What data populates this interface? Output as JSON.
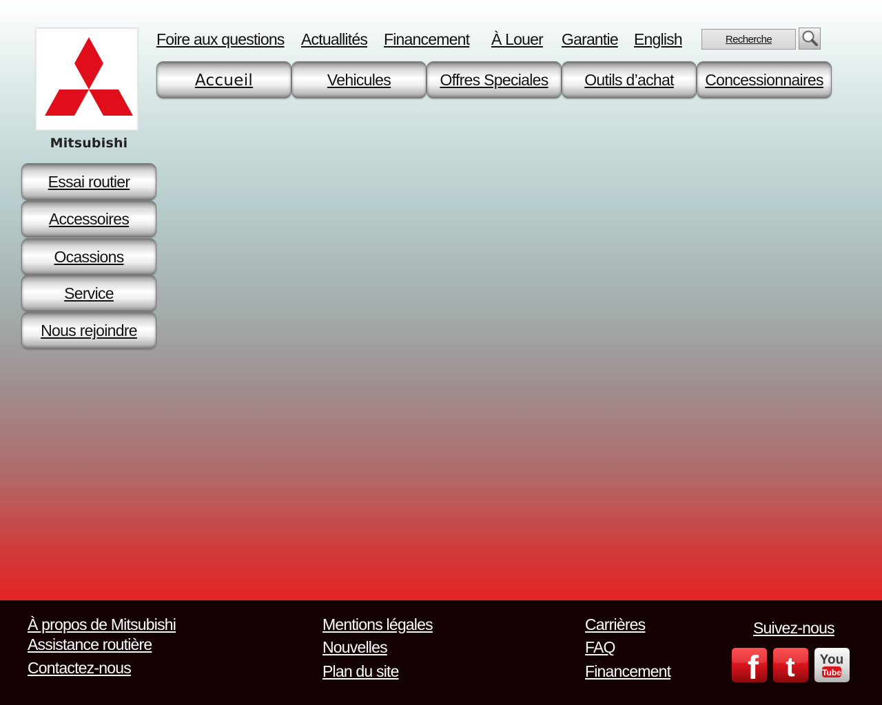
{
  "brand": {
    "name": "Mitsubishi",
    "logo_color": "#e00d1a"
  },
  "top_links": [
    {
      "label": "Foire  aux questions"
    },
    {
      "label": "Actuallités"
    },
    {
      "label": "Financement"
    },
    {
      "label": "À Louer"
    },
    {
      "label": "Garantie"
    },
    {
      "label": "English"
    }
  ],
  "search": {
    "value": "Recherche",
    "button_icon": "magnifier-icon"
  },
  "main_nav": [
    {
      "label": "Accueil"
    },
    {
      "label": "Vehicules"
    },
    {
      "label": "Offres Speciales"
    },
    {
      "label": "Outils d’achat"
    },
    {
      "label": "Concessionnaires"
    }
  ],
  "side_nav": [
    {
      "label": "Essai routier"
    },
    {
      "label": "Accessoires"
    },
    {
      "label": "Ocassions"
    },
    {
      "label": "Service"
    },
    {
      "label": "Nous rejoindre"
    }
  ],
  "footer": {
    "col1": [
      "À propos de Mitsubishi",
      "Assistance routière",
      "Contactez-nous"
    ],
    "col2": [
      "Mentions légales",
      "Nouvelles",
      "Plan du site"
    ],
    "col3": [
      "Carrières",
      "FAQ",
      "Financement"
    ],
    "follow_label": "Suivez-nous",
    "social": [
      {
        "icon": "facebook-icon",
        "text": "f"
      },
      {
        "icon": "twitter-icon",
        "text": "t"
      },
      {
        "icon": "youtube-icon",
        "text_top": "You",
        "text_bottom": "Tube"
      }
    ]
  },
  "colors": {
    "gradient_top": "#ffffff",
    "gradient_mid": "#a3aaaa",
    "gradient_bottom": "#e42424",
    "footer_bg": "#140203",
    "social_red": "#d8141c"
  }
}
